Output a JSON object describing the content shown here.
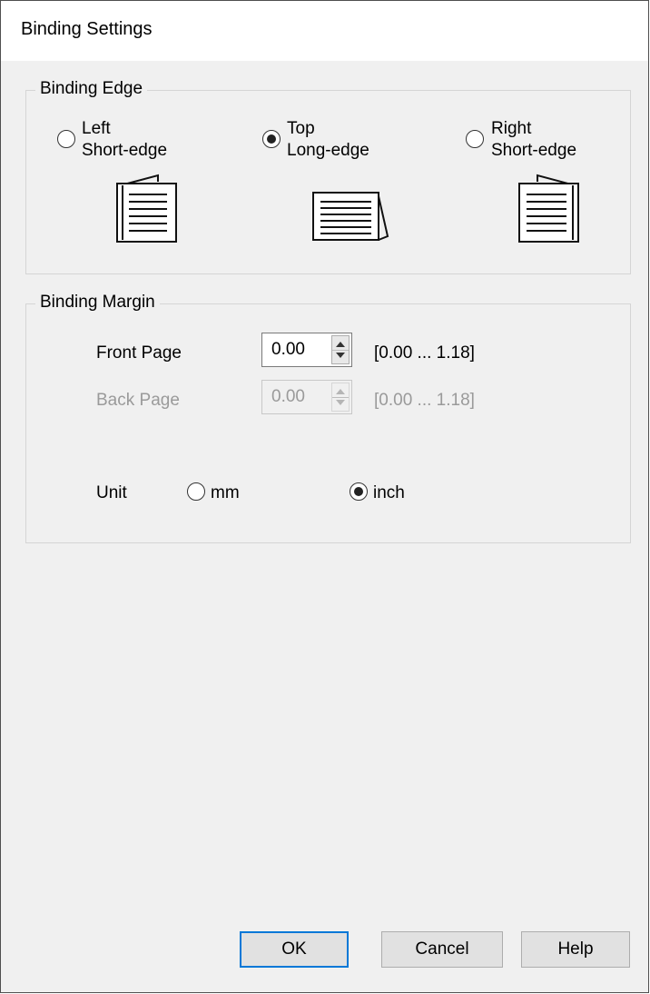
{
  "window": {
    "title": "Binding Settings"
  },
  "binding_edge": {
    "legend": "Binding Edge",
    "options": [
      {
        "line1": "Left",
        "line2": "Short-edge",
        "selected": false,
        "icon": "book-left-binding-icon"
      },
      {
        "line1": "Top",
        "line2": "Long-edge",
        "selected": true,
        "icon": "book-top-binding-icon"
      },
      {
        "line1": "Right",
        "line2": "Short-edge",
        "selected": false,
        "icon": "book-right-binding-icon"
      }
    ]
  },
  "binding_margin": {
    "legend": "Binding Margin",
    "front_page": {
      "label": "Front Page",
      "value": "0.00",
      "range": "[0.00 ... 1.18]",
      "enabled": true
    },
    "back_page": {
      "label": "Back Page",
      "value": "0.00",
      "range": "[0.00 ... 1.18]",
      "enabled": false
    },
    "unit": {
      "label": "Unit",
      "options": [
        {
          "label": "mm",
          "selected": false
        },
        {
          "label": "inch",
          "selected": true
        }
      ]
    }
  },
  "buttons": {
    "ok": "OK",
    "cancel": "Cancel",
    "help": "Help"
  }
}
